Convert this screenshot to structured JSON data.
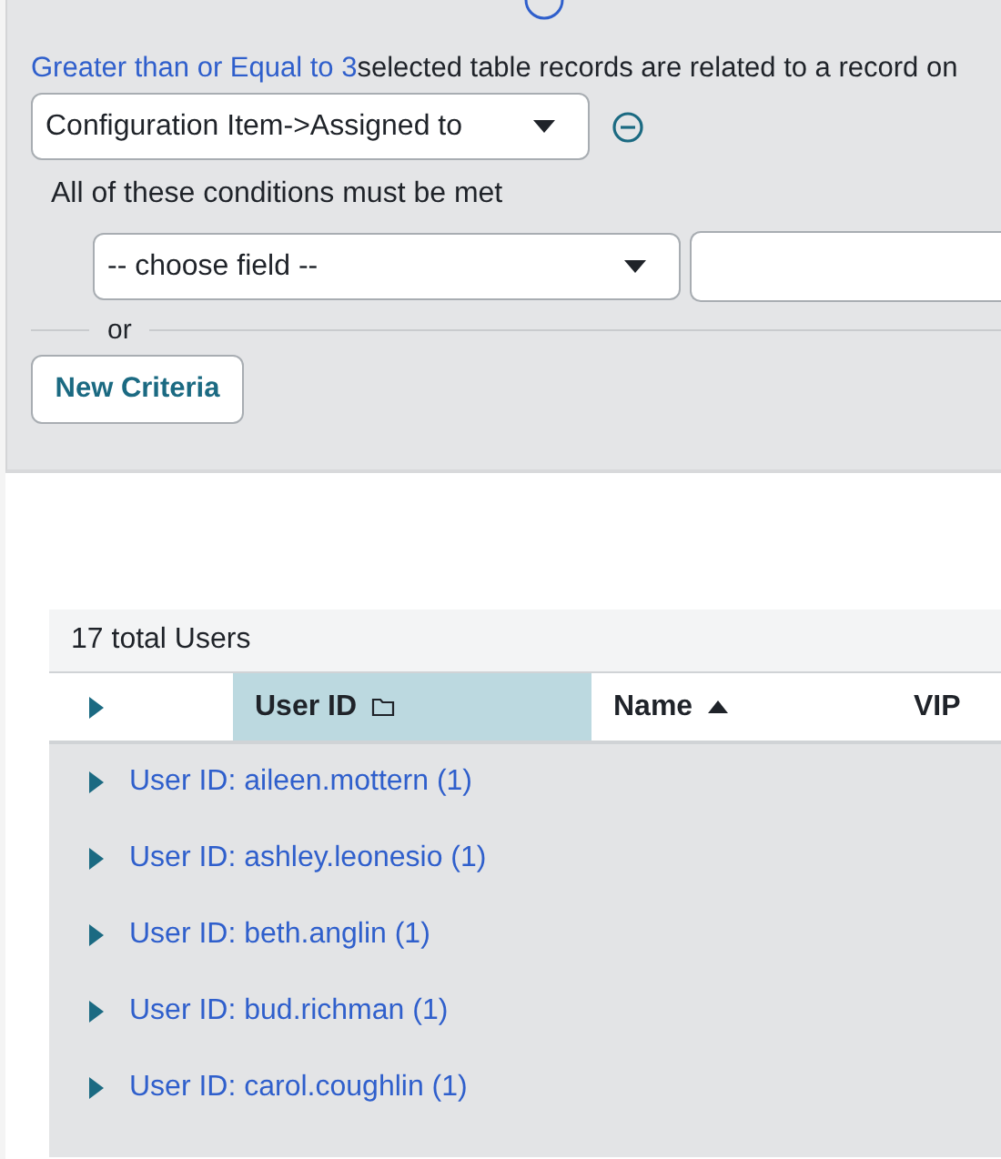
{
  "condition": {
    "count_link": "Greater than or Equal to 3",
    "sentence": "selected table records are related to a record on"
  },
  "relation_select": {
    "value": "Configuration Item->Assigned to"
  },
  "conditions_label": "All of these conditions must be met",
  "criteria": {
    "field_select": {
      "value": "-- choose field --"
    }
  },
  "or_label": "or",
  "new_criteria_button": "New Criteria",
  "list": {
    "total": "17 total Users",
    "columns": [
      {
        "label": "User ID",
        "grouped": true,
        "sorted": false
      },
      {
        "label": "Name",
        "grouped": false,
        "sorted": true
      },
      {
        "label": "VIP",
        "grouped": false,
        "sorted": false
      }
    ],
    "groups": [
      {
        "label": "User ID: aileen.mottern (1)",
        "expanded": false
      },
      {
        "label": "User ID: ashley.leonesio (1)",
        "expanded": false
      },
      {
        "label": "User ID: beth.anglin (1)",
        "expanded": false
      },
      {
        "label": "User ID: bud.richman (1)",
        "expanded": false
      },
      {
        "label": "User ID: carol.coughlin (1)",
        "expanded": false
      }
    ]
  }
}
